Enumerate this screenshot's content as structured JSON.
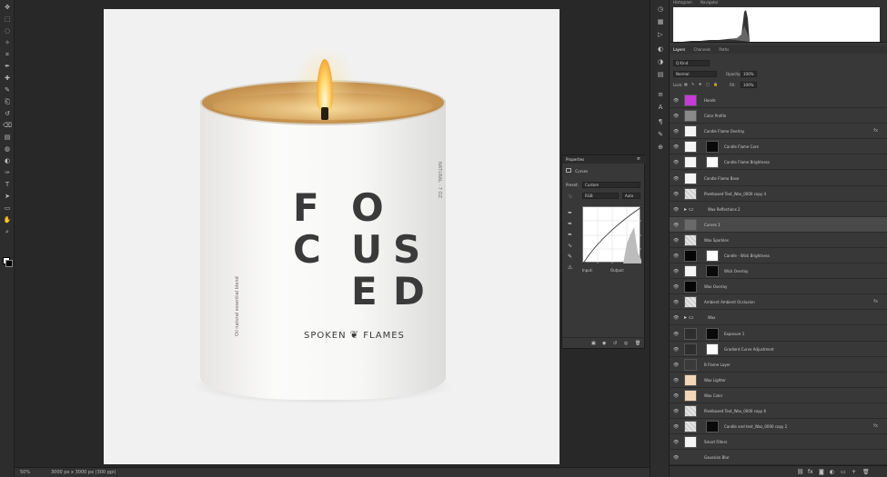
{
  "toolbar": {
    "tools": [
      "move-icon",
      "marquee-icon",
      "lasso-icon",
      "quick-select-icon",
      "crop-icon",
      "eyedropper-icon",
      "healing-icon",
      "brush-icon",
      "stamp-icon",
      "history-brush-icon",
      "eraser-icon",
      "gradient-icon",
      "blur-icon",
      "dodge-icon",
      "pen-icon",
      "type-icon",
      "path-select-icon",
      "shape-icon",
      "hand-icon",
      "zoom-icon"
    ],
    "foreground_color": "#ffffff",
    "background_color": "#000000"
  },
  "canvas": {
    "artwork": {
      "letters": [
        "F",
        "O",
        "C",
        "U",
        "S",
        "E",
        "D"
      ],
      "brand_left": "SPOKEN",
      "brand_right": "FLAMES",
      "side_text_left": "Oil natural essential blend",
      "side_text_right": "NATURAL · 7 OZ"
    }
  },
  "status_bar": {
    "zoom": "50%",
    "doc_info": "3000 px x 3000 px (300 ppi)"
  },
  "histogram": {
    "tabs": [
      "Histogram",
      "Navigator"
    ]
  },
  "layers_panel": {
    "tabs": [
      "Layers",
      "Channels",
      "Paths"
    ],
    "filter_label": "Q Kind",
    "blend_mode": "Normal",
    "opacity_label": "Opacity:",
    "opacity_value": "100%",
    "lock_label": "Lock:",
    "fill_label": "Fill:",
    "fill_value": "100%",
    "layers": [
      {
        "name": "Hands",
        "thumb": "magenta",
        "mask": false,
        "fx": false,
        "selected": false
      },
      {
        "name": "Color Profile",
        "thumb": "gray",
        "mask": false,
        "fx": false,
        "selected": false
      },
      {
        "name": "Candle Flame Overlay",
        "thumb": "white",
        "mask": false,
        "fx": true,
        "selected": false
      },
      {
        "name": "Candle Flame Core",
        "thumb": "white",
        "mask": true,
        "fx": false,
        "selected": false
      },
      {
        "name": "Candle Flame Brightness",
        "thumb": "white",
        "mask": true,
        "fx": false,
        "selected": false
      },
      {
        "name": "Candle Flame Base",
        "thumb": "white",
        "mask": false,
        "fx": false,
        "selected": false
      },
      {
        "name": "Pixelboxed Text_Wax_0000 copy 4",
        "thumb": "checker",
        "mask": false,
        "fx": false,
        "selected": false
      },
      {
        "name": "Wax Reflections 2",
        "thumb": "folder",
        "mask": false,
        "fx": false,
        "selected": false
      },
      {
        "name": "Curves 1",
        "thumb": "curves",
        "mask": false,
        "fx": false,
        "selected": true
      },
      {
        "name": "Wax Sparkles",
        "thumb": "checker",
        "mask": false,
        "fx": false,
        "selected": false
      },
      {
        "name": "Candle - Wick Brightness",
        "thumb": "black",
        "mask": true,
        "fx": false,
        "selected": false
      },
      {
        "name": "Wick Overlay",
        "thumb": "white",
        "mask": true,
        "fx": false,
        "selected": false
      },
      {
        "name": "Wax Overlay",
        "thumb": "black",
        "mask": false,
        "fx": false,
        "selected": false
      },
      {
        "name": "Ambient Ambient Occlusion",
        "thumb": "checker",
        "mask": false,
        "fx": true,
        "selected": false
      },
      {
        "name": "Wax",
        "thumb": "folder",
        "mask": false,
        "fx": false,
        "selected": false
      },
      {
        "name": "Exposure 1",
        "thumb": "adjust",
        "mask": true,
        "fx": false,
        "selected": false
      },
      {
        "name": "Gradient Curve Adjustment",
        "thumb": "adjust",
        "mask": true,
        "fx": false,
        "selected": false
      },
      {
        "name": "B Flame Layer",
        "thumb": "dark",
        "mask": false,
        "fx": false,
        "selected": false
      },
      {
        "name": "Wax Lighter",
        "thumb": "peach",
        "mask": false,
        "fx": false,
        "selected": false
      },
      {
        "name": "Wax Color",
        "thumb": "peach",
        "mask": false,
        "fx": false,
        "selected": false
      },
      {
        "name": "Pixelboxed Text_Wax_0000 copy 6",
        "thumb": "checker",
        "mask": false,
        "fx": false,
        "selected": false
      },
      {
        "name": "Candle and text_Wax_0000 copy 2",
        "thumb": "checker",
        "mask": true,
        "fx": true,
        "selected": false
      },
      {
        "name": "Smart Filters",
        "thumb": "white",
        "mask": false,
        "fx": false,
        "selected": false
      },
      {
        "name": "Gaussian Blur",
        "thumb": "none",
        "mask": false,
        "fx": false,
        "selected": false
      }
    ]
  },
  "properties_panel": {
    "title": "Properties",
    "subtitle": "Curves",
    "preset_label": "Preset:",
    "preset_value": "Custom",
    "channel_value": "RGB",
    "auto_label": "Auto",
    "input_label": "Input:",
    "output_label": "Output:"
  }
}
